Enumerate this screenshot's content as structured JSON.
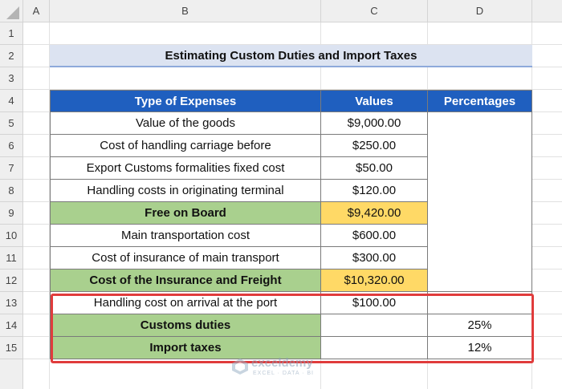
{
  "columns": [
    "A",
    "B",
    "C",
    "D"
  ],
  "rows": [
    "1",
    "2",
    "3",
    "4",
    "5",
    "6",
    "7",
    "8",
    "9",
    "10",
    "11",
    "12",
    "13",
    "14",
    "15"
  ],
  "title": "Estimating Custom Duties and Import Taxes",
  "table": {
    "headers": [
      "Type of Expenses",
      "Values",
      "Percentages"
    ],
    "rows": [
      {
        "label": "Value of the goods",
        "value": "$9,000.00",
        "pct": ""
      },
      {
        "label": "Cost of handling carriage before",
        "value": "$250.00",
        "pct": ""
      },
      {
        "label": "Export Customs formalities fixed cost",
        "value": "$50.00",
        "pct": ""
      },
      {
        "label": "Handling costs in originating terminal",
        "value": "$120.00",
        "pct": ""
      },
      {
        "label": "Free on Board",
        "value": "$9,420.00",
        "pct": ""
      },
      {
        "label": "Main transportation cost",
        "value": "$600.00",
        "pct": ""
      },
      {
        "label": "Cost of insurance of main transport",
        "value": "$300.00",
        "pct": ""
      },
      {
        "label": "Cost of the Insurance and Freight",
        "value": "$10,320.00",
        "pct": ""
      },
      {
        "label": "Handling cost on arrival at the port",
        "value": "$100.00",
        "pct": ""
      },
      {
        "label": "Customs duties",
        "value": "",
        "pct": "25%"
      },
      {
        "label": "Import taxes",
        "value": "",
        "pct": "12%"
      }
    ]
  },
  "watermark": {
    "name": "exceldemy",
    "tagline": "EXCEL · DATA · BI"
  },
  "colors": {
    "header_blue": "#1f5fbf",
    "green": "#a9d08e",
    "gold": "#ffd966",
    "highlight_red": "#e03c3c"
  }
}
